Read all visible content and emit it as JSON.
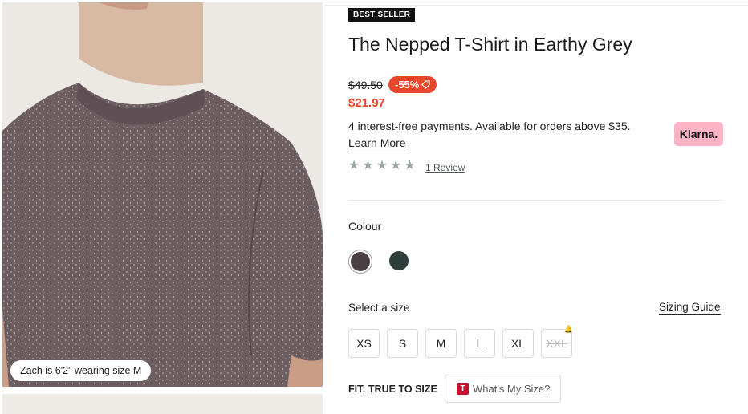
{
  "product": {
    "badge": "BEST SELLER",
    "title": "The Nepped T-Shirt in Earthy Grey",
    "price_old": "$49.50",
    "discount": "-55%",
    "price_new": "$21.97",
    "colors": {
      "sale": "#e8462a",
      "badge_bg": "#111111"
    }
  },
  "gallery": {
    "caption": "Zach is 6'2\" wearing size M"
  },
  "klarna": {
    "text": "4 interest-free payments. Available for orders above $35.",
    "learn_more": "Learn More",
    "logo": "Klarna."
  },
  "reviews": {
    "rating": 5,
    "link": "1 Review"
  },
  "colour": {
    "label": "Colour",
    "swatches": [
      "#4a3f44",
      "#2e3e3b"
    ],
    "selected_index": 0
  },
  "size": {
    "label": "Select a size",
    "guide": "Sizing Guide",
    "options": [
      "XS",
      "S",
      "M",
      "L",
      "XL",
      "XXL"
    ],
    "unavailable": [
      "XXL"
    ]
  },
  "fit": {
    "label": "FIT: TRUE TO SIZE",
    "button_logo": "T",
    "button": "What's My Size?"
  }
}
